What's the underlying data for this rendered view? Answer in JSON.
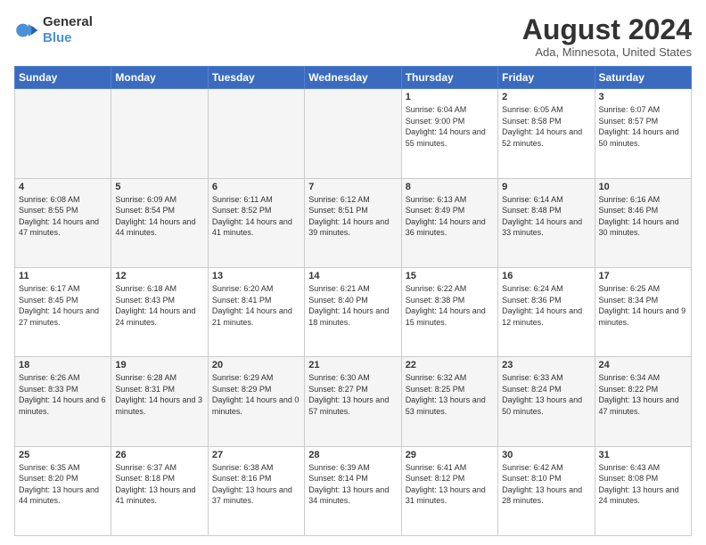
{
  "logo": {
    "line1": "General",
    "line2": "Blue"
  },
  "title": "August 2024",
  "subtitle": "Ada, Minnesota, United States",
  "days_of_week": [
    "Sunday",
    "Monday",
    "Tuesday",
    "Wednesday",
    "Thursday",
    "Friday",
    "Saturday"
  ],
  "weeks": [
    [
      {
        "day": "",
        "empty": true
      },
      {
        "day": "",
        "empty": true
      },
      {
        "day": "",
        "empty": true
      },
      {
        "day": "",
        "empty": true
      },
      {
        "day": "1",
        "sunrise": "6:04 AM",
        "sunset": "9:00 PM",
        "daylight": "14 hours and 55 minutes."
      },
      {
        "day": "2",
        "sunrise": "6:05 AM",
        "sunset": "8:58 PM",
        "daylight": "14 hours and 52 minutes."
      },
      {
        "day": "3",
        "sunrise": "6:07 AM",
        "sunset": "8:57 PM",
        "daylight": "14 hours and 50 minutes."
      }
    ],
    [
      {
        "day": "4",
        "sunrise": "6:08 AM",
        "sunset": "8:55 PM",
        "daylight": "14 hours and 47 minutes."
      },
      {
        "day": "5",
        "sunrise": "6:09 AM",
        "sunset": "8:54 PM",
        "daylight": "14 hours and 44 minutes."
      },
      {
        "day": "6",
        "sunrise": "6:11 AM",
        "sunset": "8:52 PM",
        "daylight": "14 hours and 41 minutes."
      },
      {
        "day": "7",
        "sunrise": "6:12 AM",
        "sunset": "8:51 PM",
        "daylight": "14 hours and 39 minutes."
      },
      {
        "day": "8",
        "sunrise": "6:13 AM",
        "sunset": "8:49 PM",
        "daylight": "14 hours and 36 minutes."
      },
      {
        "day": "9",
        "sunrise": "6:14 AM",
        "sunset": "8:48 PM",
        "daylight": "14 hours and 33 minutes."
      },
      {
        "day": "10",
        "sunrise": "6:16 AM",
        "sunset": "8:46 PM",
        "daylight": "14 hours and 30 minutes."
      }
    ],
    [
      {
        "day": "11",
        "sunrise": "6:17 AM",
        "sunset": "8:45 PM",
        "daylight": "14 hours and 27 minutes."
      },
      {
        "day": "12",
        "sunrise": "6:18 AM",
        "sunset": "8:43 PM",
        "daylight": "14 hours and 24 minutes."
      },
      {
        "day": "13",
        "sunrise": "6:20 AM",
        "sunset": "8:41 PM",
        "daylight": "14 hours and 21 minutes."
      },
      {
        "day": "14",
        "sunrise": "6:21 AM",
        "sunset": "8:40 PM",
        "daylight": "14 hours and 18 minutes."
      },
      {
        "day": "15",
        "sunrise": "6:22 AM",
        "sunset": "8:38 PM",
        "daylight": "14 hours and 15 minutes."
      },
      {
        "day": "16",
        "sunrise": "6:24 AM",
        "sunset": "8:36 PM",
        "daylight": "14 hours and 12 minutes."
      },
      {
        "day": "17",
        "sunrise": "6:25 AM",
        "sunset": "8:34 PM",
        "daylight": "14 hours and 9 minutes."
      }
    ],
    [
      {
        "day": "18",
        "sunrise": "6:26 AM",
        "sunset": "8:33 PM",
        "daylight": "14 hours and 6 minutes."
      },
      {
        "day": "19",
        "sunrise": "6:28 AM",
        "sunset": "8:31 PM",
        "daylight": "14 hours and 3 minutes."
      },
      {
        "day": "20",
        "sunrise": "6:29 AM",
        "sunset": "8:29 PM",
        "daylight": "14 hours and 0 minutes."
      },
      {
        "day": "21",
        "sunrise": "6:30 AM",
        "sunset": "8:27 PM",
        "daylight": "13 hours and 57 minutes."
      },
      {
        "day": "22",
        "sunrise": "6:32 AM",
        "sunset": "8:25 PM",
        "daylight": "13 hours and 53 minutes."
      },
      {
        "day": "23",
        "sunrise": "6:33 AM",
        "sunset": "8:24 PM",
        "daylight": "13 hours and 50 minutes."
      },
      {
        "day": "24",
        "sunrise": "6:34 AM",
        "sunset": "8:22 PM",
        "daylight": "13 hours and 47 minutes."
      }
    ],
    [
      {
        "day": "25",
        "sunrise": "6:35 AM",
        "sunset": "8:20 PM",
        "daylight": "13 hours and 44 minutes."
      },
      {
        "day": "26",
        "sunrise": "6:37 AM",
        "sunset": "8:18 PM",
        "daylight": "13 hours and 41 minutes."
      },
      {
        "day": "27",
        "sunrise": "6:38 AM",
        "sunset": "8:16 PM",
        "daylight": "13 hours and 37 minutes."
      },
      {
        "day": "28",
        "sunrise": "6:39 AM",
        "sunset": "8:14 PM",
        "daylight": "13 hours and 34 minutes."
      },
      {
        "day": "29",
        "sunrise": "6:41 AM",
        "sunset": "8:12 PM",
        "daylight": "13 hours and 31 minutes."
      },
      {
        "day": "30",
        "sunrise": "6:42 AM",
        "sunset": "8:10 PM",
        "daylight": "13 hours and 28 minutes."
      },
      {
        "day": "31",
        "sunrise": "6:43 AM",
        "sunset": "8:08 PM",
        "daylight": "13 hours and 24 minutes."
      }
    ]
  ]
}
